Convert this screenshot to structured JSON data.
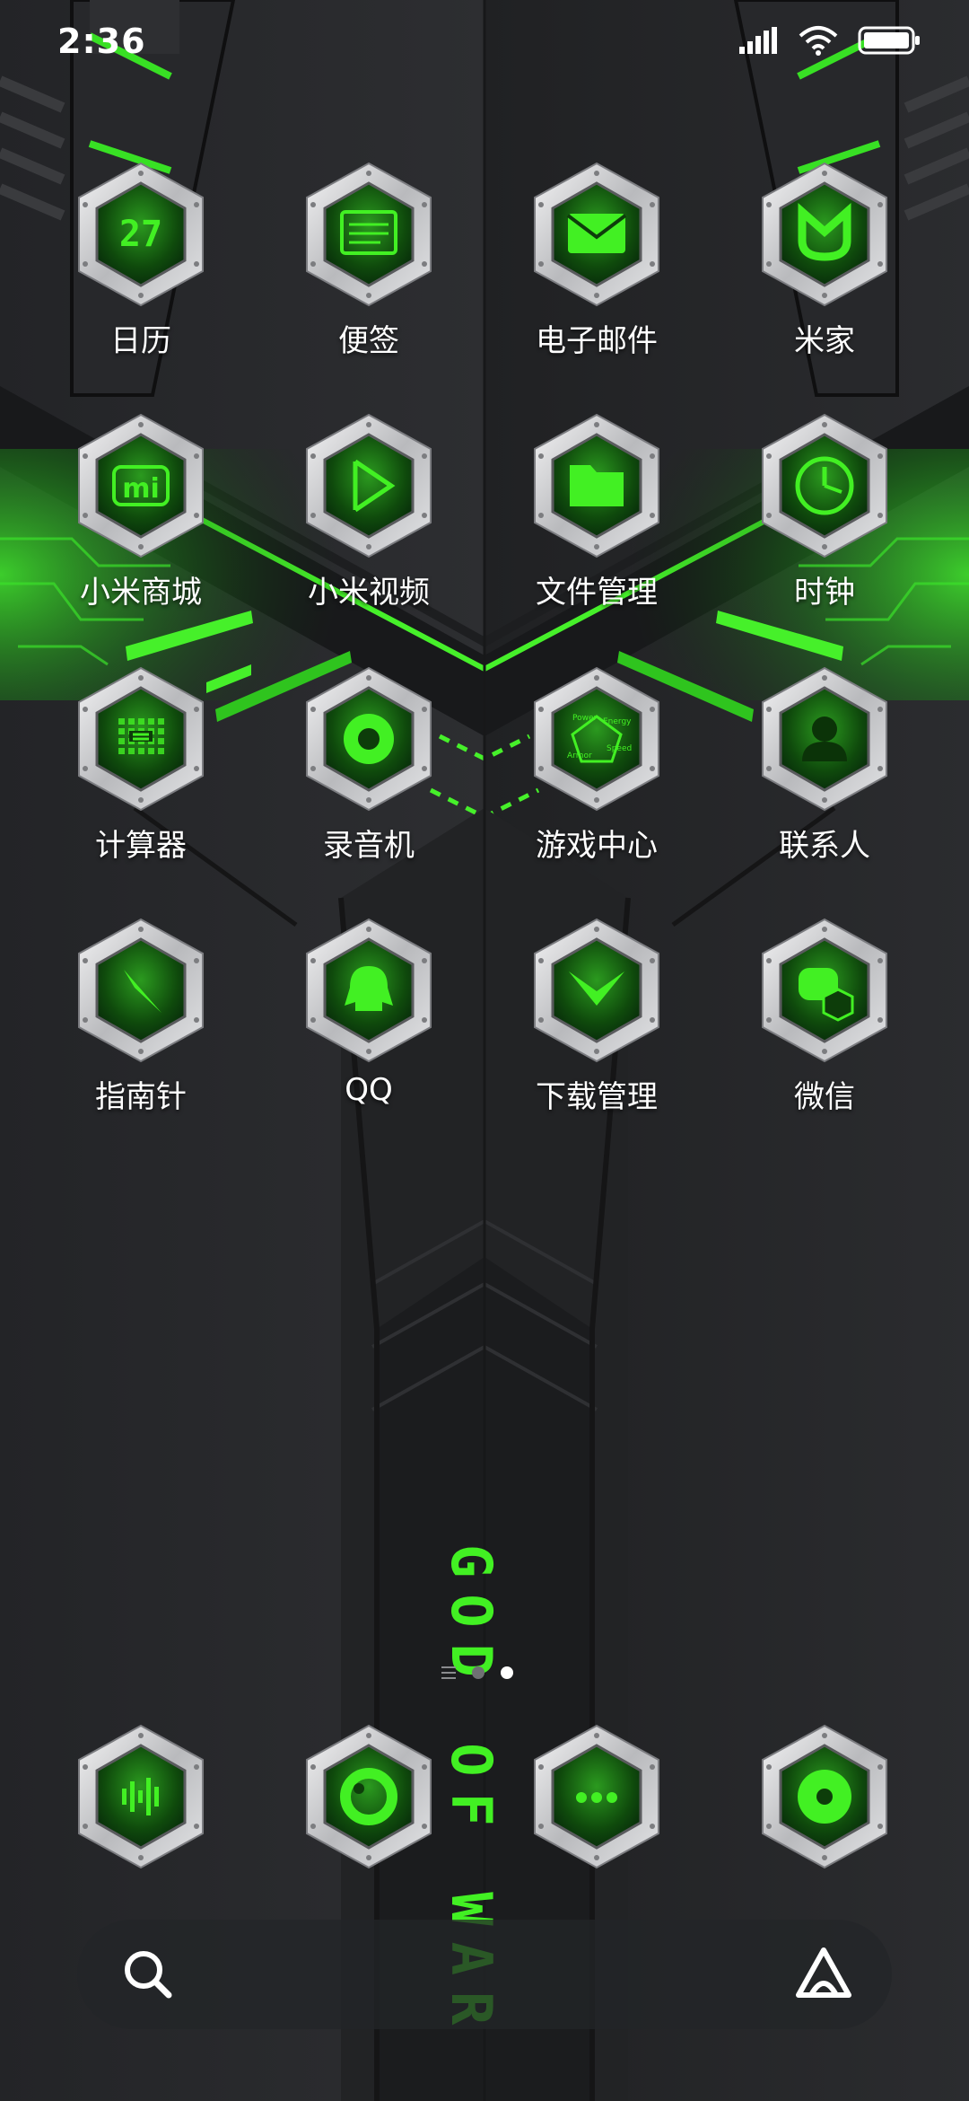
{
  "status_bar": {
    "time": "2:36",
    "icons": [
      "signal-icon",
      "wifi-icon",
      "battery-icon"
    ]
  },
  "apps": [
    {
      "label": "日历",
      "icon": "calendar-icon",
      "glyph": "27"
    },
    {
      "label": "便签",
      "icon": "notes-icon"
    },
    {
      "label": "电子邮件",
      "icon": "email-icon"
    },
    {
      "label": "米家",
      "icon": "mijia-icon"
    },
    {
      "label": "小米商城",
      "icon": "mi-store-icon",
      "glyph": "mi"
    },
    {
      "label": "小米视频",
      "icon": "video-play-icon"
    },
    {
      "label": "文件管理",
      "icon": "folder-icon"
    },
    {
      "label": "时钟",
      "icon": "clock-icon"
    },
    {
      "label": "计算器",
      "icon": "calculator-icon"
    },
    {
      "label": "录音机",
      "icon": "recorder-icon"
    },
    {
      "label": "游戏中心",
      "icon": "game-center-icon",
      "words": [
        "Power",
        "Energy",
        "Armor",
        "Speed"
      ]
    },
    {
      "label": "联系人",
      "icon": "contact-icon"
    },
    {
      "label": "指南针",
      "icon": "compass-icon"
    },
    {
      "label": "QQ",
      "icon": "qq-penguin-icon"
    },
    {
      "label": "下载管理",
      "icon": "download-icon"
    },
    {
      "label": "微信",
      "icon": "wechat-icon"
    }
  ],
  "dock": [
    {
      "icon": "phone-icon"
    },
    {
      "icon": "message-icon"
    },
    {
      "icon": "browser-icon"
    },
    {
      "icon": "camera-icon"
    }
  ],
  "pager": {
    "pages": 2,
    "current": 2
  },
  "search": {
    "icon": "search-icon",
    "assistant_icon": "assistant-icon"
  },
  "wallpaper": {
    "text": "GOD OF WAR"
  },
  "colors": {
    "accent": "#42f023",
    "background": "#1c1d1f",
    "bezel": "#d9dadc"
  }
}
